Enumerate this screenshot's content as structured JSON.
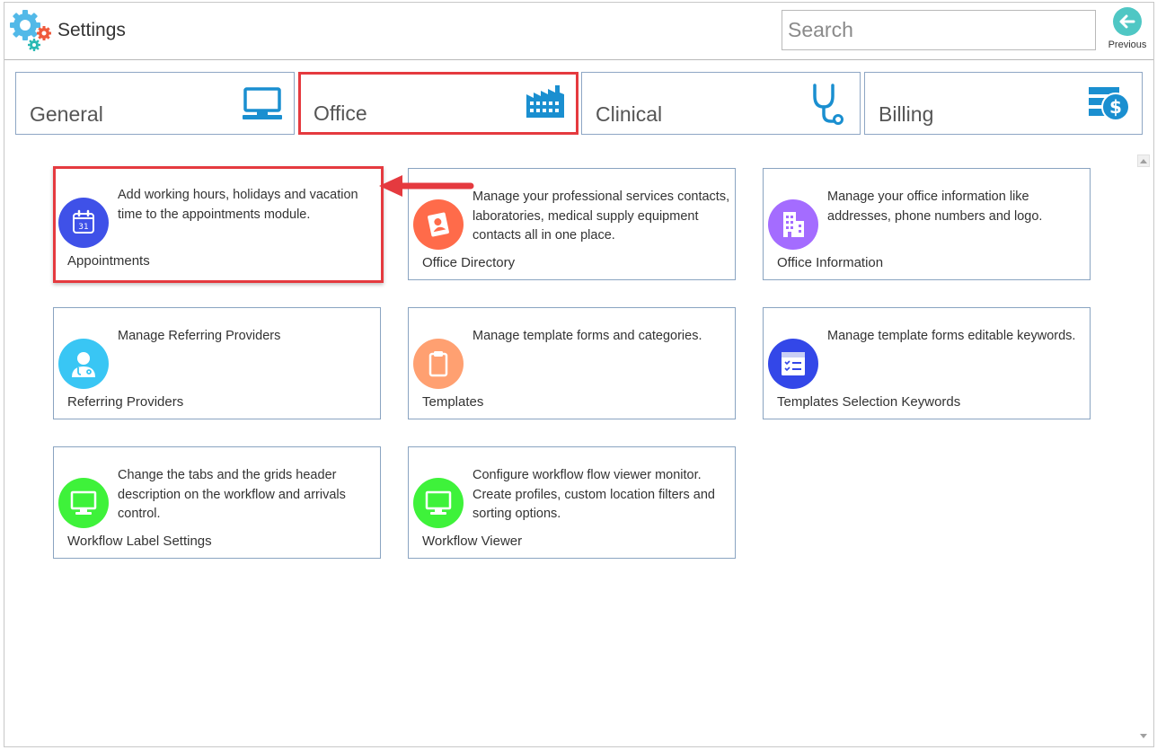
{
  "header": {
    "title": "Settings",
    "search_placeholder": "Search",
    "previous_label": "Previous",
    "app_icon": "gears-icon"
  },
  "tabs": [
    {
      "label": "General",
      "icon": "monitor-icon",
      "active": false
    },
    {
      "label": "Office",
      "icon": "factory-icon",
      "active": true
    },
    {
      "label": "Clinical",
      "icon": "stethoscope-icon",
      "active": false
    },
    {
      "label": "Billing",
      "icon": "billing-icon",
      "active": false
    }
  ],
  "cards": [
    {
      "title": "Appointments",
      "description": "Add working hours, holidays and vacation time to the appointments module.",
      "icon": "calendar-icon",
      "icon_color": "#3f51e8",
      "calendar_day": "31",
      "highlighted": true
    },
    {
      "title": "Office Directory",
      "description": "Manage your professional services contacts, laboratories, medical supply equipment contacts all in one place.",
      "icon": "contact-book-icon",
      "icon_color": "#ff6b4a"
    },
    {
      "title": "Office Information",
      "description": "Manage your office information like addresses, phone numbers and logo.",
      "icon": "building-icon",
      "icon_color": "#a46cff"
    },
    {
      "title": "Referring Providers",
      "description": "Manage Referring Providers",
      "icon": "doctor-icon",
      "icon_color": "#39c6f4"
    },
    {
      "title": "Templates",
      "description": "Manage template forms and categories.",
      "icon": "clipboard-icon",
      "icon_color": "#ffa071"
    },
    {
      "title": "Templates Selection Keywords",
      "description": "Manage template forms editable keywords.",
      "icon": "checklist-form-icon",
      "icon_color": "#3347e8"
    },
    {
      "title": "Workflow Label Settings",
      "description": "Change the tabs and the grids header description on the workflow and arrivals control.",
      "icon": "monitor-icon",
      "icon_color": "#3ef23a"
    },
    {
      "title": "Workflow Viewer",
      "description": "Configure workflow flow viewer monitor. Create profiles, custom location filters and sorting options.",
      "icon": "monitor-icon",
      "icon_color": "#3ef23a"
    }
  ],
  "colors": {
    "accent_teal": "#4fc7c4",
    "tab_icon_blue": "#1a8fd0",
    "highlight_red": "#e53a3f",
    "border_blue": "#8aa4c1"
  }
}
